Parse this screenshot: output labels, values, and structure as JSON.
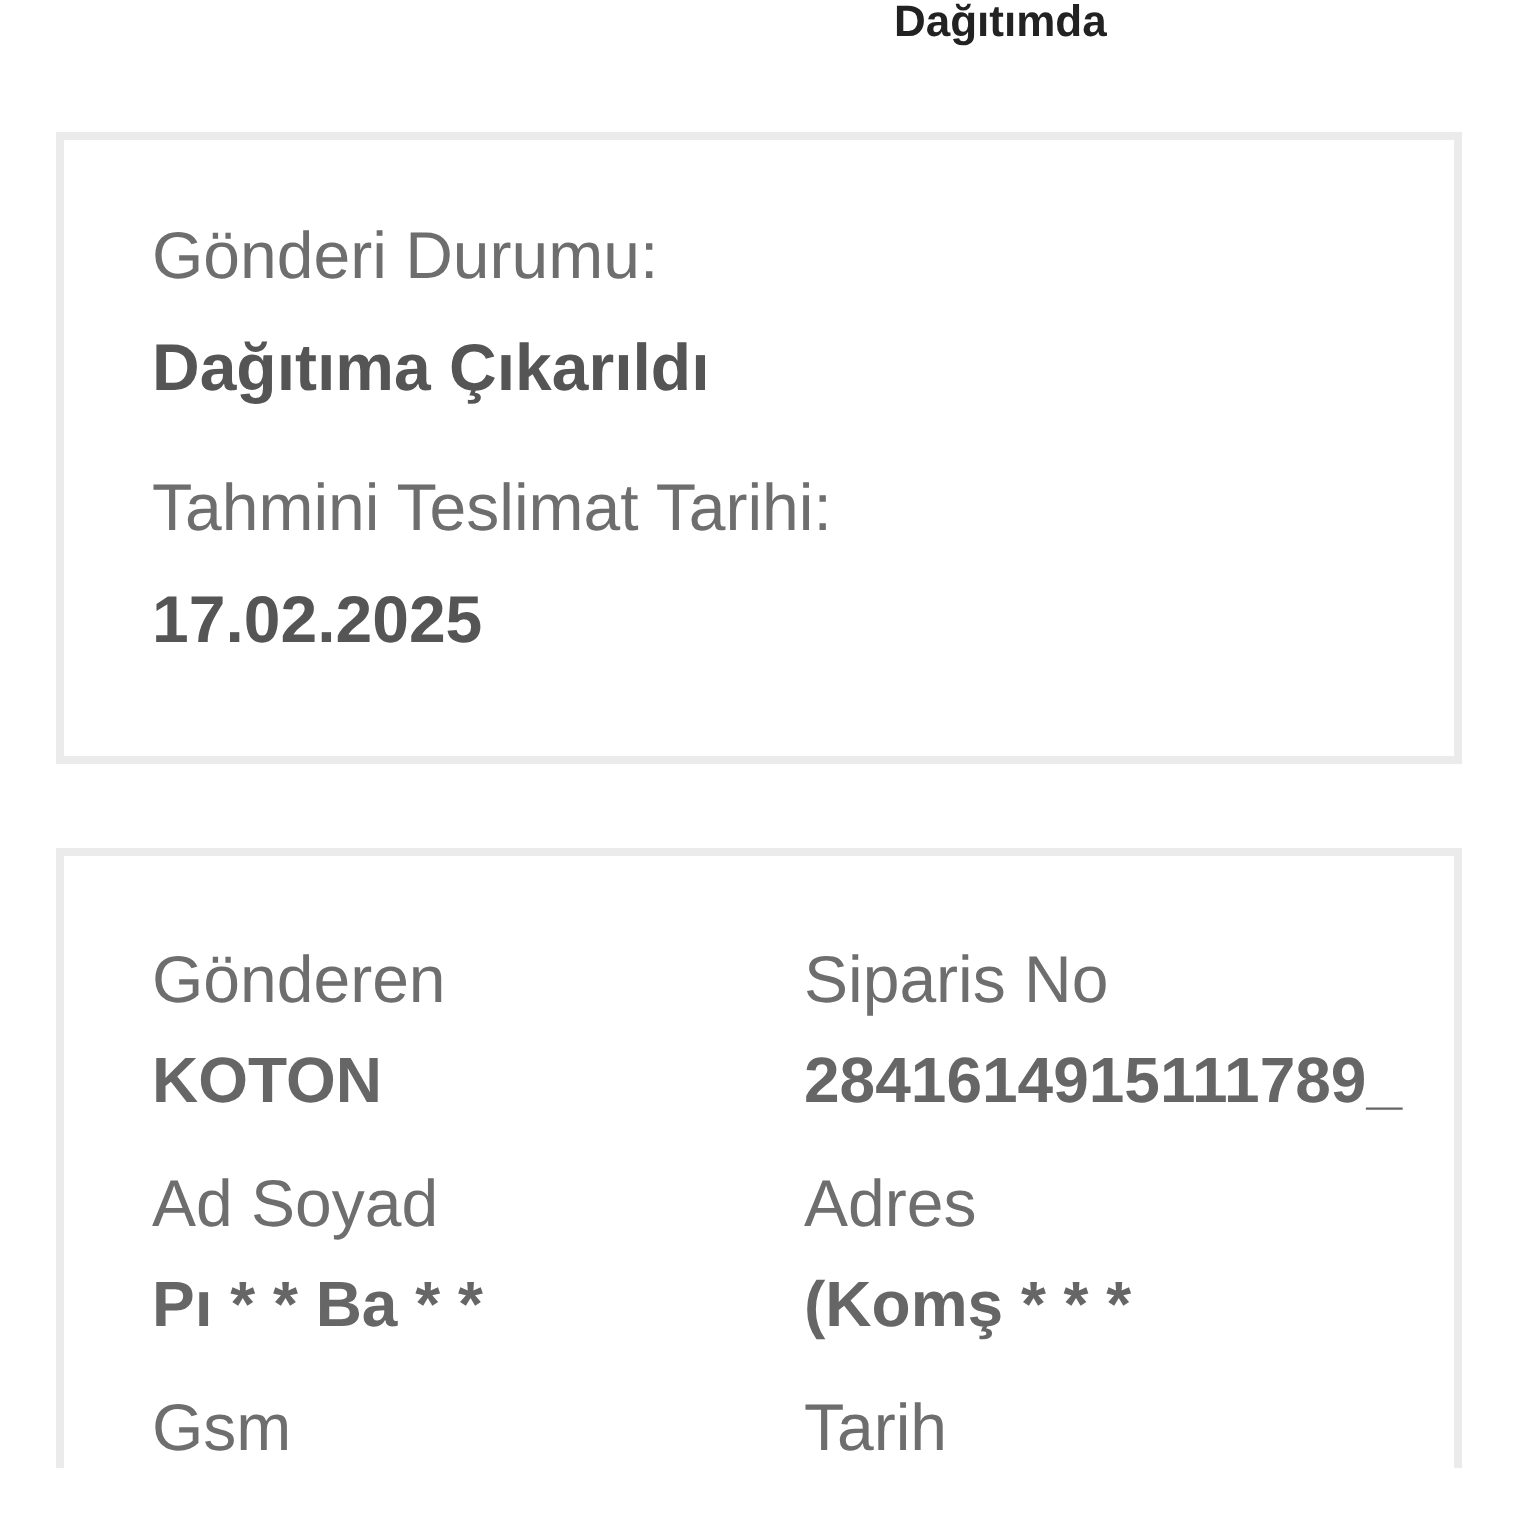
{
  "step_label": "Dağıtımda",
  "status_card": {
    "fields": [
      {
        "label": "Gönderi Durumu:",
        "value": "Dağıtıma Çıkarıldı"
      },
      {
        "label": "Tahmini Teslimat Tarihi:",
        "value": "17.02.2025"
      }
    ]
  },
  "details_card": {
    "fields": [
      {
        "label": "Gönderen",
        "value": "KOTON"
      },
      {
        "label": "Siparis No",
        "value": "2841614915111789_"
      },
      {
        "label": "Ad Soyad",
        "value": "Pı * * Ba * *"
      },
      {
        "label": "Adres",
        "value": "(Komş * * *"
      },
      {
        "label": "Gsm"
      },
      {
        "label": "Tarih"
      }
    ]
  }
}
